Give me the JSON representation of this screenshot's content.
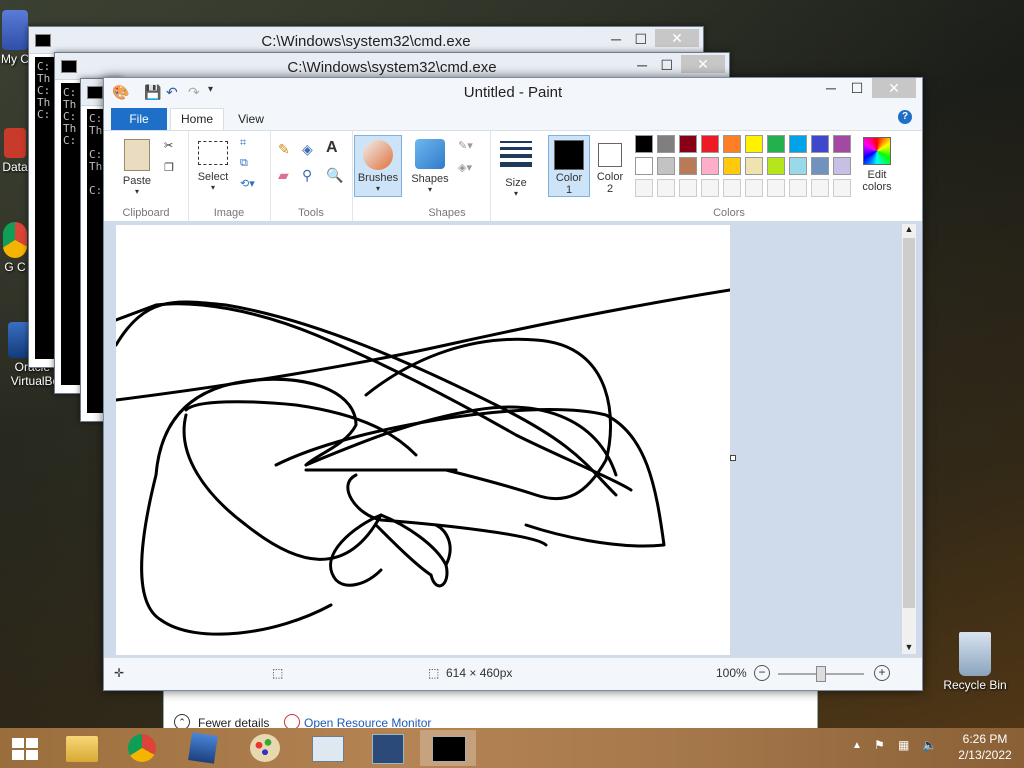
{
  "desktop": {
    "icons": [
      {
        "label": "My C",
        "name": "my-computer"
      },
      {
        "label": "Data",
        "name": "data"
      },
      {
        "label": "G C",
        "name": "google-chrome"
      },
      {
        "label": "Oracle V VirtualBox",
        "name": "virtualbox"
      },
      {
        "label": "Recycle Bin",
        "name": "recycle-bin"
      }
    ]
  },
  "cmd_windows": [
    {
      "title": "C:\\Windows\\system32\\cmd.exe",
      "lines": [
        "C:",
        "Th",
        "",
        "C:",
        "Th",
        "",
        "C:"
      ]
    },
    {
      "title": "C:\\Windows\\system32\\cmd.exe",
      "lines": [
        "C:",
        "Th",
        "",
        "C:",
        "Th",
        "",
        "C:"
      ]
    }
  ],
  "paint": {
    "title": "Untitled - Paint",
    "tabs": {
      "file": "File",
      "home": "Home",
      "view": "View"
    },
    "groups": {
      "clipboard": {
        "label": "Clipboard",
        "paste": "Paste"
      },
      "image": {
        "label": "Image",
        "select": "Select"
      },
      "tools": {
        "label": "Tools"
      },
      "brushes": {
        "label": "Brushes"
      },
      "shapes": {
        "label": "Shapes",
        "button": "Shapes"
      },
      "size": {
        "label": "Size"
      },
      "color1": {
        "label": "Color\n1"
      },
      "color2": {
        "label": "Color\n2"
      },
      "colors": {
        "label": "Colors",
        "edit": "Edit colors"
      }
    },
    "palette_row1": [
      "#000000",
      "#7f7f7f",
      "#880015",
      "#ed1c24",
      "#ff7f27",
      "#fff200",
      "#22b14c",
      "#00a2e8",
      "#3f48cc",
      "#a349a4"
    ],
    "palette_row2": [
      "#ffffff",
      "#c3c3c3",
      "#b97a57",
      "#ffaec9",
      "#ffc90e",
      "#efe4b0",
      "#b5e61d",
      "#99d9ea",
      "#7092be",
      "#c8bfe7"
    ],
    "status": {
      "size": "614 × 460px",
      "zoom": "100%"
    }
  },
  "task_manager": {
    "fewer_details": "Fewer details",
    "resource_monitor": "Open Resource Monitor"
  },
  "taskbar": {
    "time": "6:26 PM",
    "date": "2/13/2022"
  }
}
